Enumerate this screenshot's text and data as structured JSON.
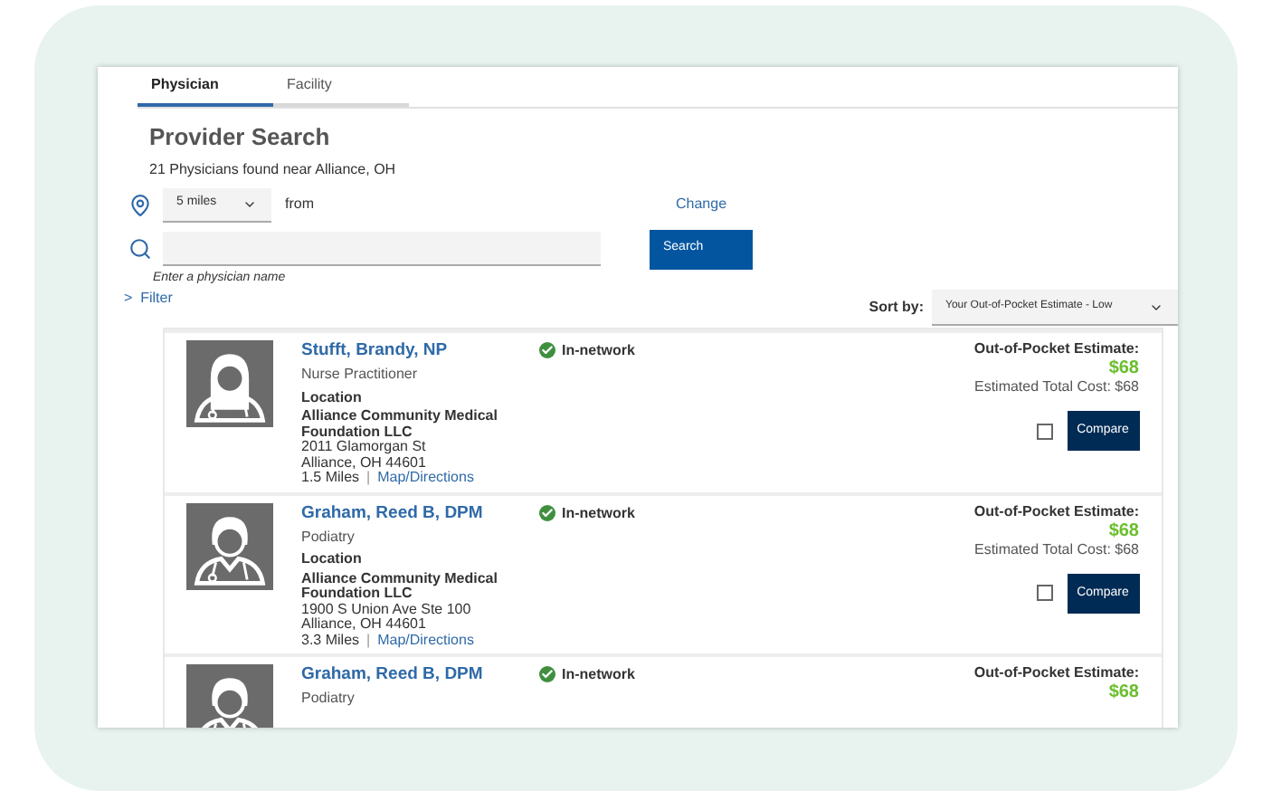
{
  "tabs": [
    {
      "label": "Physician",
      "selected": true
    },
    {
      "label": "Facility",
      "selected": false
    }
  ],
  "title": "Provider Search",
  "results_summary": "21 Physicians found near Alliance, OH",
  "distance": {
    "value": "5 miles",
    "from_label": "from",
    "change_link": "Change"
  },
  "search": {
    "hint": "Enter a physician name",
    "button": "Search"
  },
  "filter": {
    "glyph": ">",
    "label": "Filter"
  },
  "sort": {
    "label": "Sort by:",
    "value": "Your Out-of-Pocket Estimate - Low"
  },
  "providers": [
    {
      "name": "Stufft, Brandy, NP",
      "specialty": "Nurse Practitioner",
      "kind": "female",
      "network": "In-network",
      "location_label": "Location",
      "facility": "Alliance Community Medical Foundation LLC",
      "address": [
        "2011 Glamorgan St",
        "Alliance, OH 44601"
      ],
      "distance": "1.5 Miles",
      "separator": "|",
      "map_link": "Map/Directions",
      "estimate_label": "Out-of-Pocket Estimate:",
      "estimate": "$68",
      "total_cost": "Estimated Total Cost: $68",
      "compare_checked": false,
      "compare_button": "Compare"
    },
    {
      "name": "Graham, Reed B, DPM",
      "specialty": "Podiatry",
      "kind": "male",
      "network": "In-network",
      "location_label": "Location",
      "facility": "Alliance Community Medical Foundation LLC",
      "address": [
        "1900 S Union Ave Ste 100",
        "Alliance, OH 44601"
      ],
      "distance": "3.3 Miles",
      "separator": "|",
      "map_link": "Map/Directions",
      "estimate_label": "Out-of-Pocket Estimate:",
      "estimate": "$68",
      "total_cost": "Estimated Total Cost: $68",
      "compare_checked": false,
      "compare_button": "Compare"
    },
    {
      "name": "Graham, Reed B, DPM",
      "specialty": "Podiatry",
      "kind": "male",
      "network": "In-network",
      "estimate_label": "Out-of-Pocket Estimate:",
      "estimate": "$68"
    }
  ]
}
